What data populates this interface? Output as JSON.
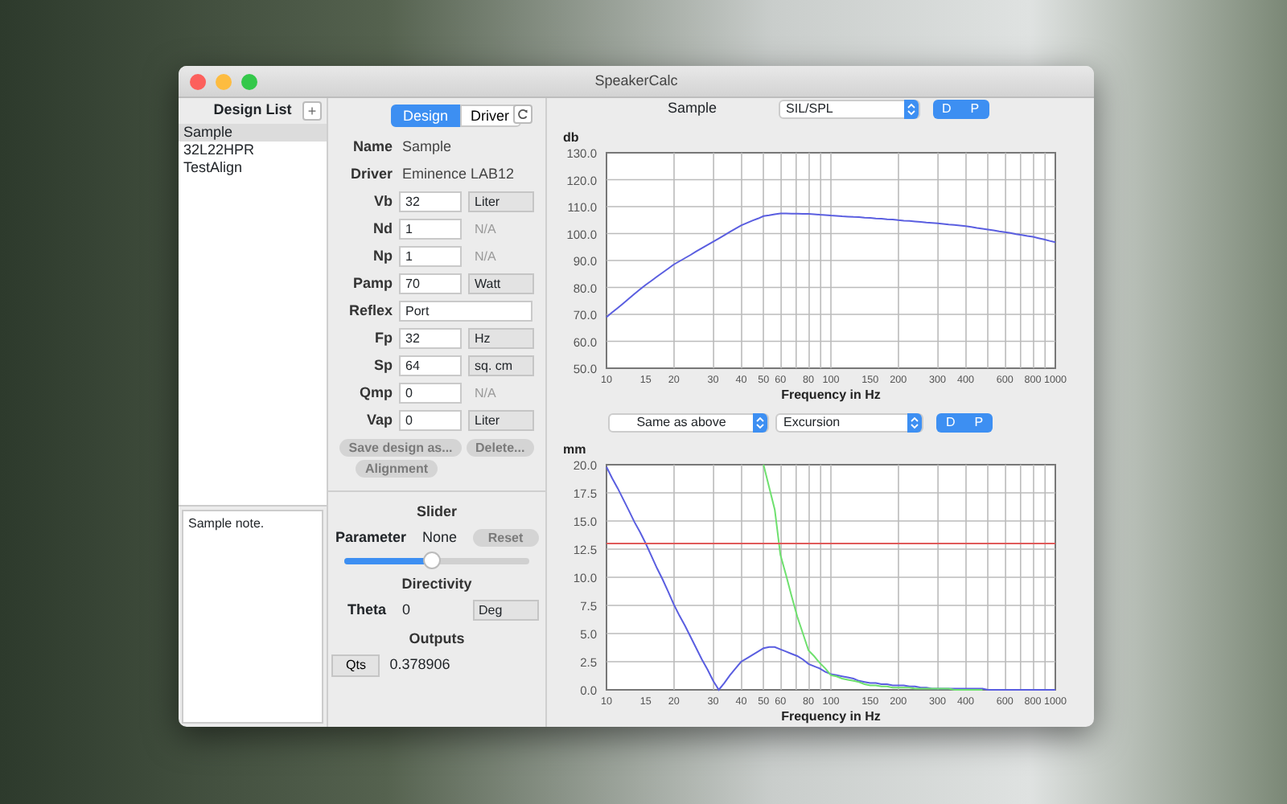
{
  "window": {
    "title": "SpeakerCalc"
  },
  "design_list": {
    "title": "Design List",
    "add_button": "+",
    "items": [
      {
        "label": "Sample",
        "selected": true
      },
      {
        "label": "32L22HPR",
        "selected": false
      },
      {
        "label": "TestAlign",
        "selected": false
      }
    ],
    "note": "Sample note."
  },
  "tabs": [
    {
      "label": "Design",
      "selected": true
    },
    {
      "label": "Driver",
      "selected": false
    }
  ],
  "info": [
    {
      "label": "Name",
      "value": "Sample"
    },
    {
      "label": "Driver",
      "value": "Eminence LAB12"
    }
  ],
  "params": [
    {
      "kind": "unit",
      "label": "Vb",
      "value": "32",
      "unit": "Liter"
    },
    {
      "kind": "na",
      "label": "Nd",
      "value": "1",
      "unit": "N/A"
    },
    {
      "kind": "na",
      "label": "Np",
      "value": "1",
      "unit": "N/A"
    },
    {
      "kind": "unit",
      "label": "Pamp",
      "value": "70",
      "unit": "Watt"
    },
    {
      "kind": "wide",
      "label": "Reflex",
      "value": "Port"
    },
    {
      "kind": "unit",
      "label": "Fp",
      "value": "32",
      "unit": "Hz"
    },
    {
      "kind": "unit",
      "label": "Sp",
      "value": "64",
      "unit": "sq. cm"
    },
    {
      "kind": "na",
      "label": "Qmp",
      "value": "0",
      "unit": "N/A"
    },
    {
      "kind": "unit",
      "label": "Vap",
      "value": "0",
      "unit": "Liter"
    }
  ],
  "actions": [
    {
      "label": "Save design as...",
      "disabled": true
    },
    {
      "label": "Delete...",
      "disabled": true
    },
    {
      "label": "Alignment",
      "disabled": true
    }
  ],
  "slider": {
    "title": "Slider",
    "label": "Parameter",
    "value": "None",
    "reset": {
      "label": "Reset",
      "disabled": true
    },
    "level": 0.47
  },
  "directivity": {
    "title": "Directivity",
    "label": "Theta",
    "value": "0",
    "unit": "Deg"
  },
  "outputs": {
    "title": "Outputs",
    "button": "Qts",
    "value": "0.378906"
  },
  "top_chart": {
    "caption": "Sample",
    "select": "SIL/SPL",
    "buttons": [
      "D",
      "P"
    ],
    "chart_data": {
      "type": "line",
      "grid": true,
      "ylabel": "db",
      "xlabel": "Frequency in Hz",
      "categories": [
        "10",
        null,
        null,
        null,
        null,
        null,
        null,
        "15",
        null,
        null,
        null,
        null,
        "20",
        null,
        null,
        null,
        null,
        null,
        null,
        "30",
        null,
        null,
        null,
        null,
        "40",
        null,
        null,
        null,
        "50",
        null,
        null,
        "60",
        null,
        null,
        null,
        null,
        "80",
        null,
        null,
        null,
        "100",
        null,
        null,
        null,
        null,
        null,
        null,
        "150",
        null,
        null,
        null,
        null,
        "200",
        null,
        null,
        null,
        null,
        null,
        null,
        "300",
        null,
        null,
        null,
        null,
        "400",
        null,
        null,
        null,
        null,
        null,
        null,
        "600",
        null,
        null,
        null,
        null,
        "800",
        null,
        null,
        null,
        "1000"
      ],
      "series": [
        {
          "color": "#5a5ee0",
          "values": [
            69,
            70.7,
            72.4,
            74.1,
            75.9,
            77.6,
            79.3,
            81,
            82.5,
            84,
            85.5,
            87,
            88.5,
            89.7,
            90.9,
            92.1,
            93.4,
            94.6,
            95.8,
            97,
            98.2,
            99.4,
            100.6,
            101.8,
            103,
            103.9,
            104.8,
            105.6,
            106.5,
            106.8,
            107.2,
            107.5,
            107.5,
            107.4,
            107.4,
            107.3,
            107.3,
            107.2,
            107,
            106.9,
            106.7,
            106.6,
            106.4,
            106.3,
            106.2,
            106.1,
            105.9,
            105.8,
            105.6,
            105.5,
            105.3,
            105.2,
            105,
            104.8,
            104.7,
            104.5,
            104.3,
            104.1,
            104,
            103.8,
            103.6,
            103.4,
            103.2,
            103,
            102.8,
            102.5,
            102.1,
            101.8,
            101.5,
            101.2,
            100.8,
            100.5,
            100.2,
            99.8,
            99.5,
            99.1,
            98.8,
            98.3,
            97.8,
            97.3,
            96.8
          ]
        }
      ],
      "ylim": [
        50,
        130
      ],
      "yticks": [
        {
          "value": 50,
          "label": "50.0"
        },
        {
          "value": 60,
          "label": "60.0"
        },
        {
          "value": 70,
          "label": "70.0"
        },
        {
          "value": 80,
          "label": "80.0"
        },
        {
          "value": 90,
          "label": "90.0"
        },
        {
          "value": 100,
          "label": "100.0"
        },
        {
          "value": 110,
          "label": "110.0"
        },
        {
          "value": 120,
          "label": "120.0"
        },
        {
          "value": 130,
          "label": "130.0"
        }
      ]
    }
  },
  "bottom_chart": {
    "selects": [
      "Same as above",
      "Excursion"
    ],
    "buttons": [
      "D",
      "P"
    ],
    "chart_data": {
      "type": "line",
      "grid": true,
      "ylabel": "mm",
      "xlabel": "Frequency in Hz",
      "categories": [
        "10",
        null,
        null,
        null,
        null,
        null,
        null,
        "15",
        null,
        null,
        null,
        null,
        "20",
        null,
        null,
        null,
        null,
        null,
        null,
        "30",
        null,
        null,
        null,
        null,
        "40",
        null,
        null,
        null,
        "50",
        null,
        null,
        "60",
        null,
        null,
        null,
        null,
        "80",
        null,
        null,
        null,
        "100",
        null,
        null,
        null,
        null,
        null,
        null,
        "150",
        null,
        null,
        null,
        null,
        "200",
        null,
        null,
        null,
        null,
        null,
        null,
        "300",
        null,
        null,
        null,
        null,
        "400",
        null,
        null,
        null,
        null,
        null,
        null,
        "600",
        null,
        null,
        null,
        null,
        "800",
        null,
        null,
        null,
        "1000"
      ],
      "series": [
        {
          "color": "#5a5ee0",
          "values": [
            19.8,
            18.8,
            17.9,
            16.9,
            15.9,
            14.9,
            14,
            13,
            11.9,
            10.8,
            9.8,
            8.7,
            7.6,
            6.6,
            5.7,
            4.7,
            3.7,
            2.7,
            1.8,
            0.8,
            0,
            0.6,
            1.3,
            1.9,
            2.5,
            2.8,
            3.1,
            3.4,
            3.7,
            3.8,
            3.8,
            3.6,
            3.4,
            3.2,
            3,
            2.7,
            2.3,
            2.1,
            1.9,
            1.6,
            1.4,
            1.3,
            1.2,
            1.1,
            1,
            0.8,
            0.7,
            0.6,
            0.6,
            0.5,
            0.5,
            0.4,
            0.4,
            0.4,
            0.3,
            0.3,
            0.2,
            0.2,
            0.1,
            0.1,
            0.1,
            0.1,
            0.1,
            0.1,
            0.1,
            0.1,
            0.1,
            0.1,
            0,
            0,
            0,
            0,
            0,
            0,
            0,
            0,
            0,
            0,
            0,
            0,
            0
          ]
        },
        {
          "color": "#6ee06e",
          "values": [
            null,
            null,
            null,
            null,
            null,
            null,
            null,
            null,
            null,
            null,
            null,
            null,
            null,
            null,
            null,
            null,
            null,
            null,
            null,
            null,
            null,
            null,
            null,
            null,
            null,
            null,
            null,
            null,
            20,
            18,
            16,
            12,
            10.2,
            8.3,
            6.5,
            5,
            3.5,
            3,
            2.4,
            1.9,
            1.3,
            1.2,
            1,
            0.9,
            0.8,
            0.7,
            0.5,
            0.4,
            0.4,
            0.3,
            0.3,
            0.2,
            0.2,
            0.2,
            0.2,
            0.1,
            0.1,
            0.1,
            0.1,
            0.1,
            0.1,
            0.1,
            0,
            0,
            0,
            0,
            0,
            0,
            null,
            null,
            null,
            null,
            null,
            null,
            null,
            null,
            null,
            null,
            null,
            null,
            null
          ]
        },
        {
          "color": "#e05a5a",
          "values": [
            13,
            13,
            13,
            13,
            13,
            13,
            13,
            13,
            13,
            13,
            13,
            13,
            13,
            13,
            13,
            13,
            13,
            13,
            13,
            13,
            13,
            13,
            13,
            13,
            13,
            13,
            13,
            13,
            13,
            13,
            13,
            13,
            13,
            13,
            13,
            13,
            13,
            13,
            13,
            13,
            13,
            13,
            13,
            13,
            13,
            13,
            13,
            13,
            13,
            13,
            13,
            13,
            13,
            13,
            13,
            13,
            13,
            13,
            13,
            13,
            13,
            13,
            13,
            13,
            13,
            13,
            13,
            13,
            13,
            13,
            13,
            13,
            13,
            13,
            13,
            13,
            13,
            13,
            13,
            13,
            13
          ]
        }
      ],
      "ylim": [
        0,
        20
      ],
      "yticks": [
        {
          "value": 0,
          "label": "0.0"
        },
        {
          "value": 2.5,
          "label": "2.5"
        },
        {
          "value": 5,
          "label": "5.0"
        },
        {
          "value": 7.5,
          "label": "7.5"
        },
        {
          "value": 10,
          "label": "10.0"
        },
        {
          "value": 12.5,
          "label": "12.5"
        },
        {
          "value": 15,
          "label": "15.0"
        },
        {
          "value": 17.5,
          "label": "17.5"
        },
        {
          "value": 20,
          "label": "20.0"
        }
      ]
    }
  }
}
